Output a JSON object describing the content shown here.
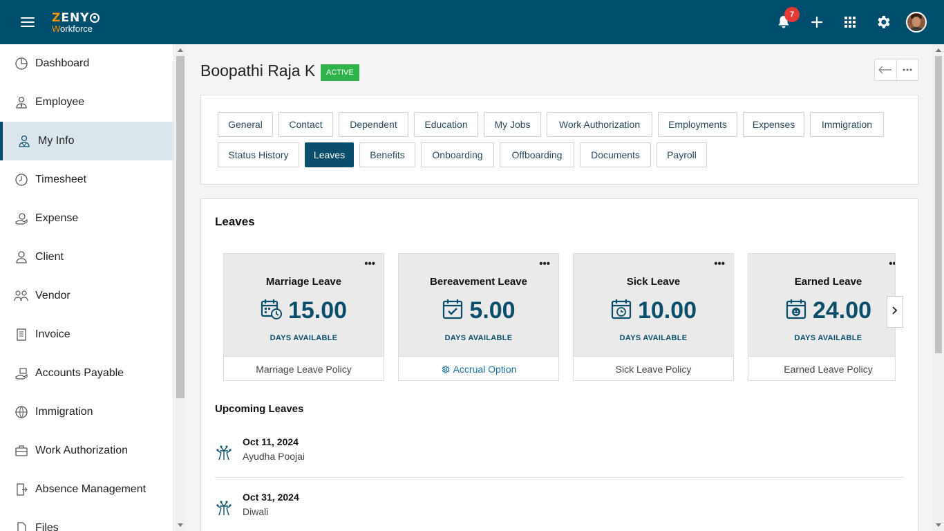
{
  "app": {
    "logo_line1_prefix": "Z",
    "logo_line1_rest": "ENY",
    "logo_line2_prefix": "W",
    "logo_line2_rest": "orkforce",
    "notification_count": "7"
  },
  "sidebar": {
    "items": [
      {
        "label": "Dashboard",
        "icon": "dashboard-icon"
      },
      {
        "label": "Employee",
        "icon": "employee-icon"
      },
      {
        "label": "My Info",
        "icon": "my-info-icon",
        "active": true
      },
      {
        "label": "Timesheet",
        "icon": "timesheet-icon"
      },
      {
        "label": "Expense",
        "icon": "expense-icon"
      },
      {
        "label": "Client",
        "icon": "client-icon"
      },
      {
        "label": "Vendor",
        "icon": "vendor-icon"
      },
      {
        "label": "Invoice",
        "icon": "invoice-icon"
      },
      {
        "label": "Accounts Payable",
        "icon": "accounts-payable-icon"
      },
      {
        "label": "Immigration",
        "icon": "immigration-icon"
      },
      {
        "label": "Work Authorization",
        "icon": "work-authorization-icon"
      },
      {
        "label": "Absence Management",
        "icon": "absence-management-icon"
      },
      {
        "label": "Files",
        "icon": "files-icon"
      }
    ]
  },
  "employee": {
    "name": "Boopathi Raja K",
    "status": "ACTIVE"
  },
  "tabs": {
    "row1": [
      "General",
      "Contact",
      "Dependent",
      "Education",
      "My Jobs",
      "Work Authorization",
      "Employments",
      "Expenses",
      "Immigration"
    ],
    "row2": [
      "Status History",
      "Leaves",
      "Benefits",
      "Onboarding",
      "Offboarding",
      "Documents",
      "Payroll"
    ],
    "active": "Leaves"
  },
  "leaves": {
    "title": "Leaves",
    "cards": [
      {
        "title": "Marriage Leave",
        "value": "15.00",
        "caption": "DAYS AVAILABLE",
        "footer": "Marriage Leave Policy",
        "icon": "calendar-clock-icon"
      },
      {
        "title": "Bereavement Leave",
        "value": "5.00",
        "caption": "DAYS AVAILABLE",
        "footer": "Accrual Option",
        "icon": "calendar-check-icon"
      },
      {
        "title": "Sick Leave",
        "value": "10.00",
        "caption": "DAYS AVAILABLE",
        "footer": "Sick Leave Policy",
        "icon": "calendar-timer-icon"
      },
      {
        "title": "Earned Leave",
        "value": "24.00",
        "caption": "DAYS AVAILABLE",
        "footer": "Earned Leave Policy",
        "icon": "calendar-smile-icon"
      }
    ],
    "more_label": "•••"
  },
  "upcoming": {
    "title": "Upcoming Leaves",
    "items": [
      {
        "date": "Oct 11, 2024",
        "name": "Ayudha Poojai"
      },
      {
        "date": "Oct 31, 2024",
        "name": "Diwali"
      }
    ]
  },
  "colors": {
    "topbar": "#004e6e",
    "accent": "#0b4e6b",
    "active_badge": "#2eb34a",
    "notification_badge": "#e53935",
    "logo_orange": "#f39200"
  }
}
